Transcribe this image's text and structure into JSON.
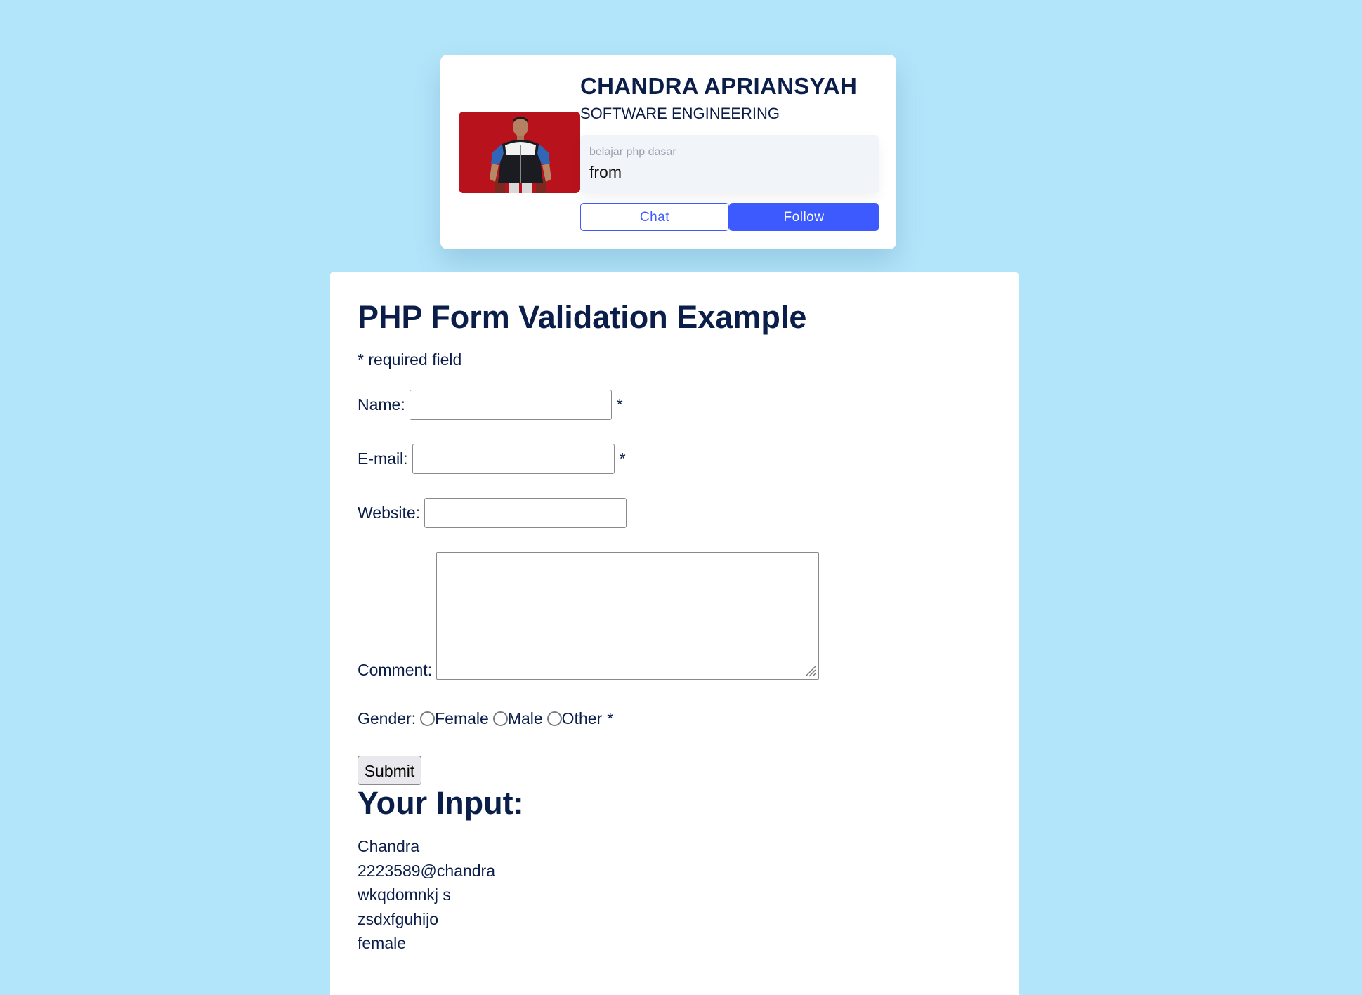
{
  "profile": {
    "name": "CHANDRA APRIANSYAH",
    "role": "SOFTWARE ENGINEERING",
    "info_caption": "belajar php dasar",
    "info_value": "from",
    "chat_label": "Chat",
    "follow_label": "Follow",
    "accent_color": "#3d5afe"
  },
  "form": {
    "title": "PHP Form Validation Example",
    "required_note": "* required field",
    "name_label": "Name:",
    "email_label": "E-mail:",
    "website_label": "Website:",
    "comment_label": "Comment:",
    "gender_label": "Gender:",
    "required_star": "*",
    "name_value": "",
    "email_value": "",
    "website_value": "",
    "comment_value": "",
    "gender_options": [
      {
        "label": "Female",
        "checked": false
      },
      {
        "label": "Male",
        "checked": false
      },
      {
        "label": "Other",
        "checked": false
      }
    ],
    "submit_label": "Submit"
  },
  "output": {
    "title": "Your Input:",
    "lines": [
      "Chandra",
      "2223589@chandra",
      "wkqdomnkj s",
      "zsdxfguhijo",
      "female"
    ]
  },
  "colors": {
    "page_background": "#b3e5fa",
    "text_primary": "#0b1e4a"
  }
}
